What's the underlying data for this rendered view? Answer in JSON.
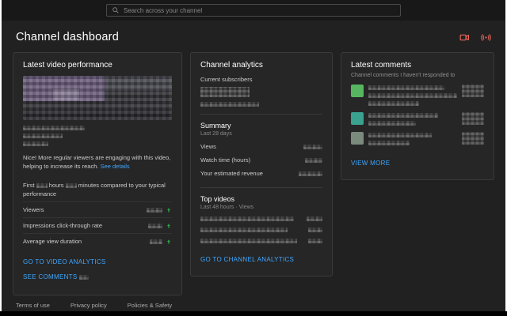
{
  "topbar": {
    "search_placeholder": "Search across your channel"
  },
  "page": {
    "title": "Channel dashboard"
  },
  "latest_video": {
    "title": "Latest video performance",
    "note": "Nice! More regular viewers are engaging with this video, helping to increase its reach.",
    "note_link": "See details",
    "compare_part1": "First",
    "compare_part2": "hours",
    "compare_part3": "minutes compared to your typical",
    "compare_part4": "performance",
    "metrics": [
      {
        "label": "Viewers"
      },
      {
        "label": "Impressions click-through rate"
      },
      {
        "label": "Average view duration"
      }
    ],
    "link_analytics": "GO TO VIDEO ANALYTICS",
    "link_comments": "SEE COMMENTS"
  },
  "channel_analytics": {
    "title": "Channel analytics",
    "current_subscribers_label": "Current subscribers",
    "summary": {
      "title": "Summary",
      "period": "Last 28 days",
      "rows": [
        {
          "label": "Views"
        },
        {
          "label": "Watch time (hours)"
        },
        {
          "label": "Your estimated revenue"
        }
      ]
    },
    "top_videos": {
      "title": "Top videos",
      "period": "Last 48 hours · Views"
    },
    "link": "GO TO CHANNEL ANALYTICS"
  },
  "latest_comments": {
    "title": "Latest comments",
    "subtitle": "Channel comments I haven't responded to",
    "view_more": "VIEW MORE"
  },
  "footer": {
    "links": [
      {
        "label": "Terms of use"
      },
      {
        "label": "Privacy policy"
      },
      {
        "label": "Policies & Safety"
      }
    ]
  },
  "colors": {
    "accent_blue": "#3ea6ff",
    "positive_green": "#2ba640",
    "brand_red": "#ff6c60",
    "page_bg": "#212121",
    "card_bg": "#262626"
  }
}
